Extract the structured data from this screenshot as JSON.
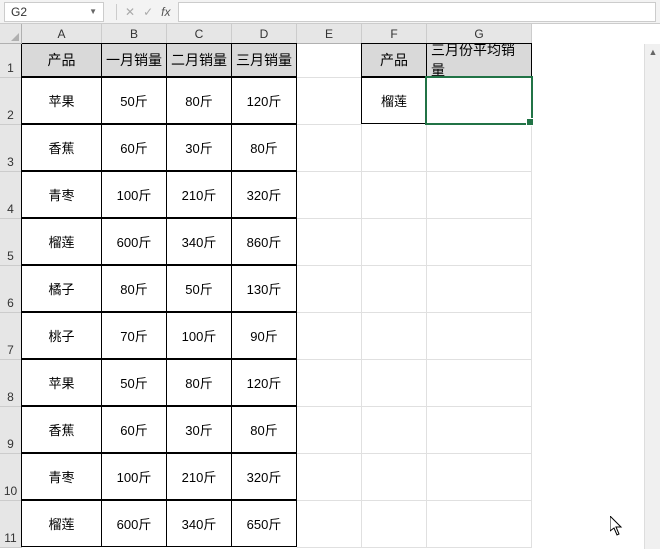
{
  "name_box": "G2",
  "formula": "",
  "columns": [
    "A",
    "B",
    "C",
    "D",
    "E",
    "F",
    "G"
  ],
  "rows": [
    "1",
    "2",
    "3",
    "4",
    "5",
    "6",
    "7",
    "8",
    "9",
    "10",
    "11"
  ],
  "headers": {
    "product": "产品",
    "jan": "一月销量",
    "feb": "二月销量",
    "mar": "三月销量",
    "lk_product": "产品",
    "lk_avg3": "三月份平均销量"
  },
  "data": [
    {
      "p": "苹果",
      "jan": "50斤",
      "feb": "80斤",
      "mar": "120斤"
    },
    {
      "p": "香蕉",
      "jan": "60斤",
      "feb": "30斤",
      "mar": "80斤"
    },
    {
      "p": "青枣",
      "jan": "100斤",
      "feb": "210斤",
      "mar": "320斤"
    },
    {
      "p": "榴莲",
      "jan": "600斤",
      "feb": "340斤",
      "mar": "860斤"
    },
    {
      "p": "橘子",
      "jan": "80斤",
      "feb": "50斤",
      "mar": "130斤"
    },
    {
      "p": "桃子",
      "jan": "70斤",
      "feb": "100斤",
      "mar": "90斤"
    },
    {
      "p": "苹果",
      "jan": "50斤",
      "feb": "80斤",
      "mar": "120斤"
    },
    {
      "p": "香蕉",
      "jan": "60斤",
      "feb": "30斤",
      "mar": "80斤"
    },
    {
      "p": "青枣",
      "jan": "100斤",
      "feb": "210斤",
      "mar": "320斤"
    },
    {
      "p": "榴莲",
      "jan": "600斤",
      "feb": "340斤",
      "mar": "650斤"
    }
  ],
  "lookup": {
    "product": "榴莲",
    "avg3": ""
  },
  "chart_data": {
    "type": "table",
    "title": "",
    "columns": [
      "产品",
      "一月销量",
      "二月销量",
      "三月销量"
    ],
    "rows": [
      [
        "苹果",
        "50斤",
        "80斤",
        "120斤"
      ],
      [
        "香蕉",
        "60斤",
        "30斤",
        "80斤"
      ],
      [
        "青枣",
        "100斤",
        "210斤",
        "320斤"
      ],
      [
        "榴莲",
        "600斤",
        "340斤",
        "860斤"
      ],
      [
        "橘子",
        "80斤",
        "50斤",
        "130斤"
      ],
      [
        "桃子",
        "70斤",
        "100斤",
        "90斤"
      ],
      [
        "苹果",
        "50斤",
        "80斤",
        "120斤"
      ],
      [
        "香蕉",
        "60斤",
        "30斤",
        "80斤"
      ],
      [
        "青枣",
        "100斤",
        "210斤",
        "320斤"
      ],
      [
        "榴莲",
        "600斤",
        "340斤",
        "650斤"
      ]
    ]
  }
}
